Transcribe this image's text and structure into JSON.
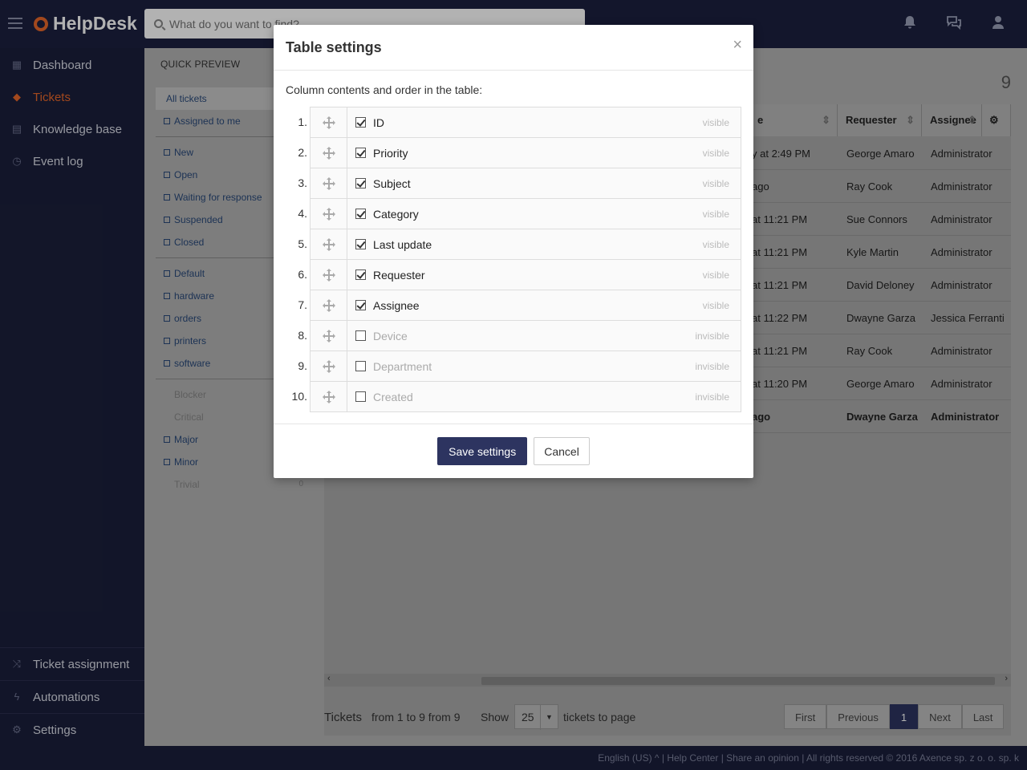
{
  "app": {
    "name": "HelpDesk"
  },
  "search": {
    "placeholder": "What do you want to find?"
  },
  "topicons": [
    "bell-icon",
    "chat-icon",
    "user-icon"
  ],
  "sidebar": {
    "items": [
      {
        "label": "Dashboard",
        "icon": "grid-icon"
      },
      {
        "label": "Tickets",
        "icon": "ticket-icon",
        "active": true
      },
      {
        "label": "Knowledge base",
        "icon": "book-icon"
      },
      {
        "label": "Event log",
        "icon": "clock-icon"
      }
    ],
    "bottom": [
      {
        "label": "Ticket assignment",
        "icon": "shuffle-icon"
      },
      {
        "label": "Automations",
        "icon": "bolt-icon"
      },
      {
        "label": "Settings",
        "icon": "gears-icon"
      }
    ]
  },
  "panel": {
    "title": "QUICK PREVIEW",
    "views": [
      "All tickets",
      "Assigned to me"
    ],
    "statuses": [
      "New",
      "Open",
      "Waiting for response",
      "Suspended",
      "Closed"
    ],
    "categories": [
      "Default",
      "hardware",
      "orders",
      "printers",
      "software"
    ],
    "priorities": [
      "Blocker",
      "Critical",
      "Major",
      "Minor",
      "Trivial"
    ],
    "trivial_count": "0"
  },
  "main": {
    "count": "9",
    "headers": [
      "e",
      "Requester",
      "Assignee"
    ],
    "rows": [
      [
        "y at 2:49 PM",
        "George Amaro",
        "Administrator"
      ],
      [
        "ago",
        "Ray Cook",
        "Administrator"
      ],
      [
        "at 11:21 PM",
        "Sue Connors",
        "Administrator"
      ],
      [
        "at 11:21 PM",
        "Kyle Martin",
        "Administrator"
      ],
      [
        "at 11:21 PM",
        "David Deloney",
        "Administrator"
      ],
      [
        "at 11:22 PM",
        "Dwayne Garza",
        "Jessica Ferranti"
      ],
      [
        "at 11:21 PM",
        "Ray Cook",
        "Administrator"
      ],
      [
        "at 11:20 PM",
        "George Amaro",
        "Administrator"
      ],
      [
        "ago",
        "Dwayne Garza",
        "Administrator"
      ]
    ]
  },
  "footer": {
    "tickets_label": "Tickets",
    "range": "from 1 to 9 from 9",
    "show": "Show",
    "per_page": "25",
    "per_page_suffix": "tickets to page",
    "pager": [
      "First",
      "Previous",
      "1",
      "Next",
      "Last"
    ]
  },
  "bottombar": "English (US) ^ | Help Center | Share an opinion | All rights reserved © 2016 Axence sp. z o. o. sp. k",
  "modal": {
    "title": "Table settings",
    "close": "×",
    "description": "Column contents and order in the table:",
    "columns": [
      {
        "num": "1.",
        "name": "ID",
        "checked": true,
        "state": "visible"
      },
      {
        "num": "2.",
        "name": "Priority",
        "checked": true,
        "state": "visible"
      },
      {
        "num": "3.",
        "name": "Subject",
        "checked": true,
        "state": "visible"
      },
      {
        "num": "4.",
        "name": "Category",
        "checked": true,
        "state": "visible"
      },
      {
        "num": "5.",
        "name": "Last update",
        "checked": true,
        "state": "visible"
      },
      {
        "num": "6.",
        "name": "Requester",
        "checked": true,
        "state": "visible"
      },
      {
        "num": "7.",
        "name": "Assignee",
        "checked": true,
        "state": "visible"
      },
      {
        "num": "8.",
        "name": "Device",
        "checked": false,
        "state": "invisible"
      },
      {
        "num": "9.",
        "name": "Department",
        "checked": false,
        "state": "invisible"
      },
      {
        "num": "10.",
        "name": "Created",
        "checked": false,
        "state": "invisible"
      }
    ],
    "save_label": "Save settings",
    "cancel_label": "Cancel"
  }
}
